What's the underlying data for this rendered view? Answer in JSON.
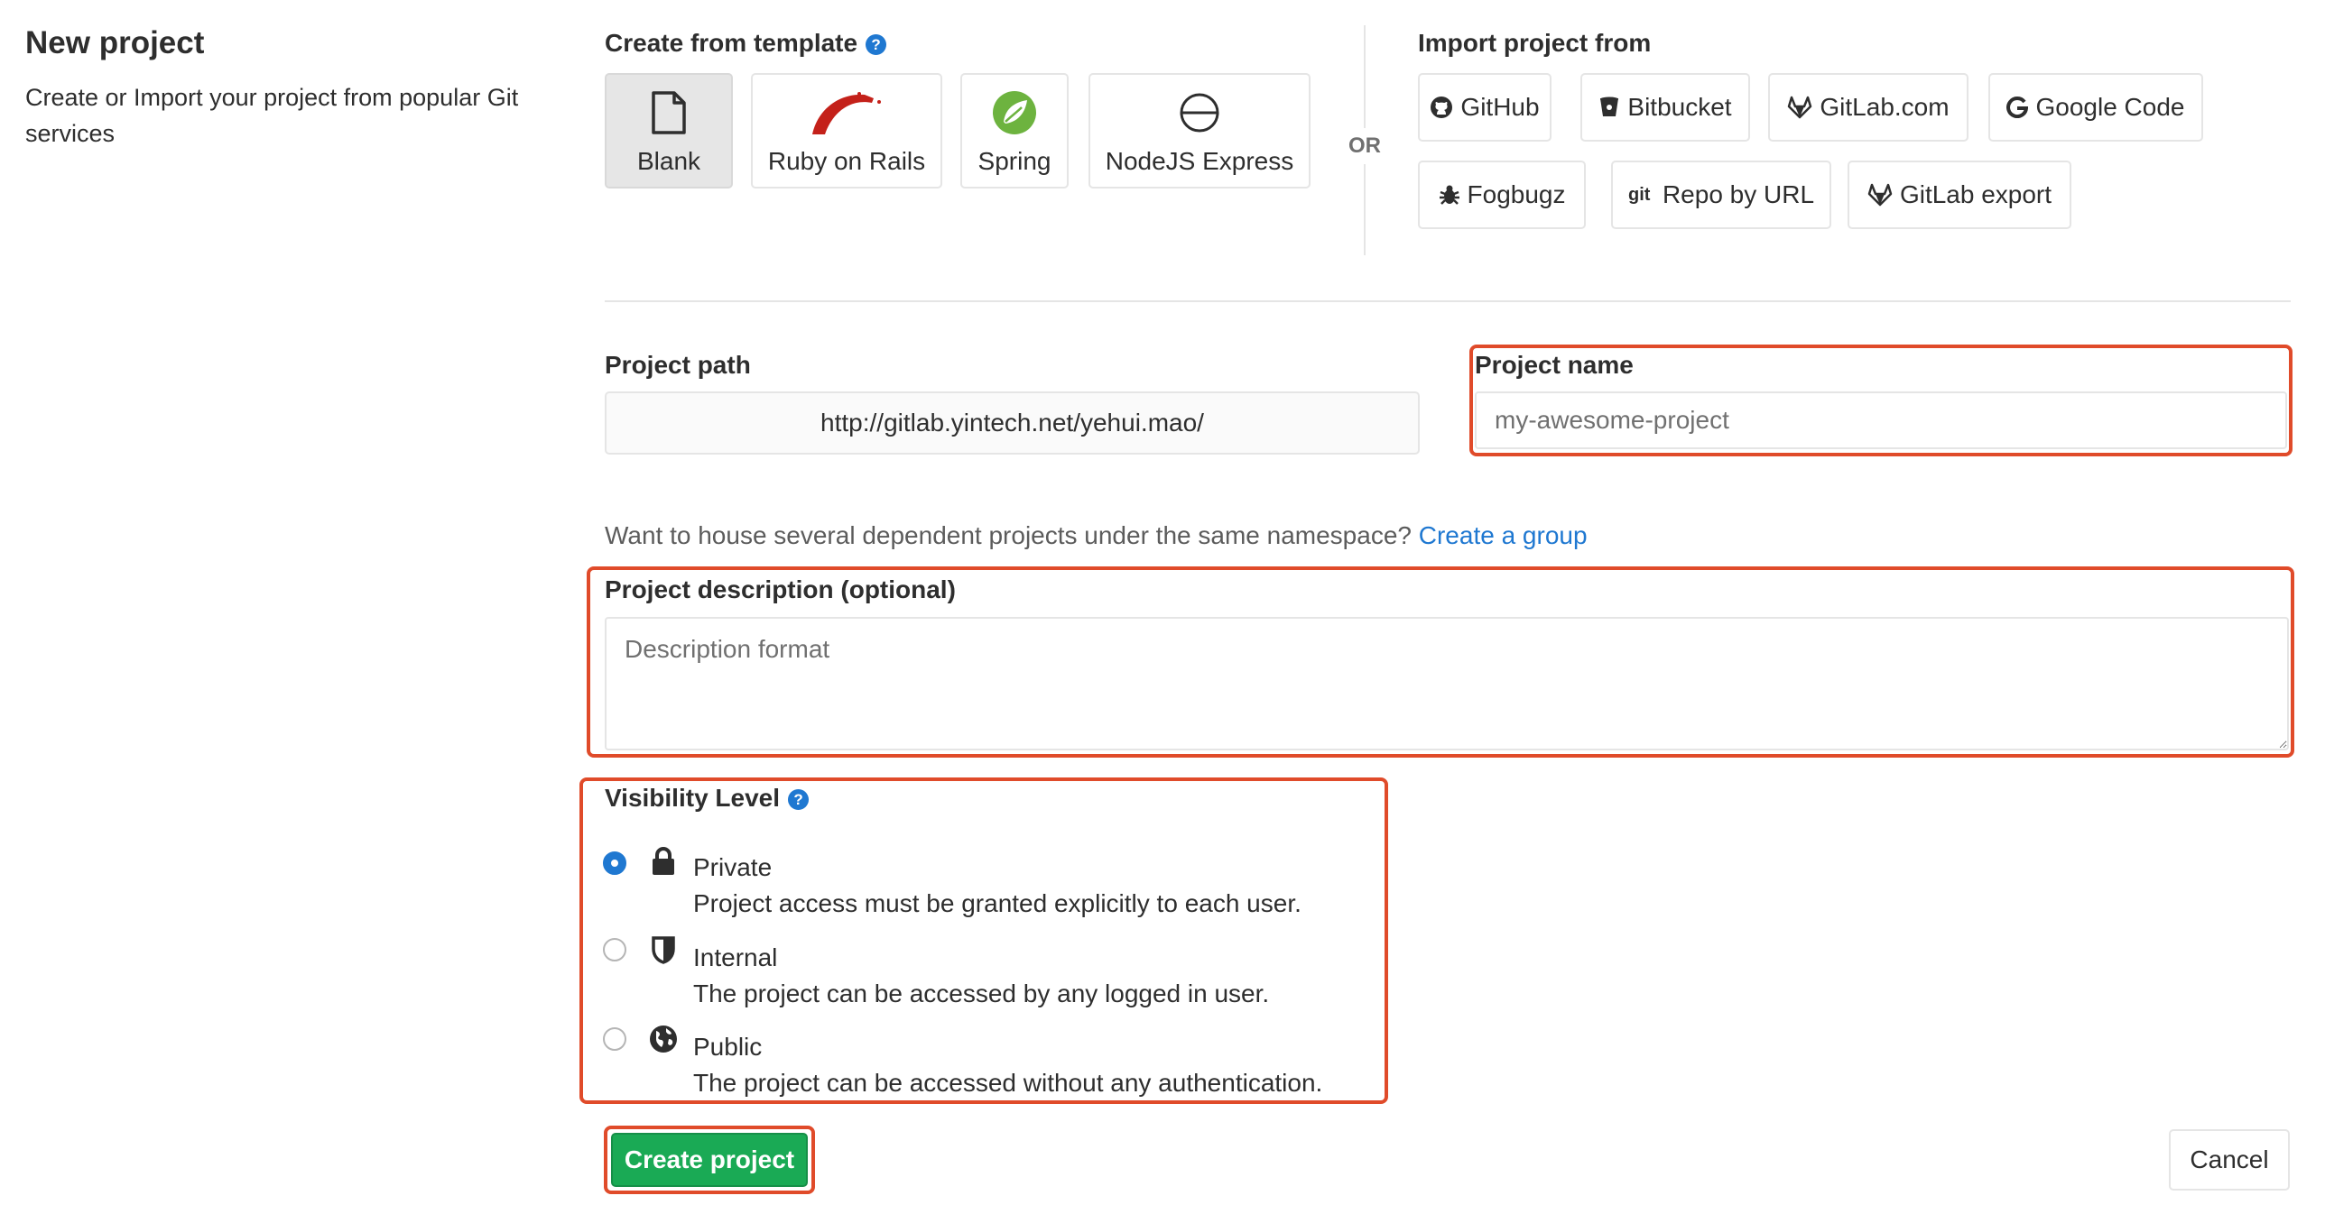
{
  "intro": {
    "title": "New project",
    "subtitle": "Create or Import your project from popular Git services"
  },
  "templates": {
    "title": "Create from template",
    "items": [
      {
        "label": "Blank",
        "icon": "file-icon",
        "active": true
      },
      {
        "label": "Ruby on Rails",
        "icon": "rails-icon"
      },
      {
        "label": "Spring",
        "icon": "spring-icon"
      },
      {
        "label": "NodeJS Express",
        "icon": "express-icon"
      }
    ]
  },
  "divider": {
    "or_text": "OR"
  },
  "import": {
    "title": "Import project from",
    "items": [
      {
        "label": "GitHub",
        "icon": "github-icon"
      },
      {
        "label": "Bitbucket",
        "icon": "bitbucket-icon"
      },
      {
        "label": "GitLab.com",
        "icon": "gitlab-icon"
      },
      {
        "label": "Google Code",
        "icon": "google-icon"
      },
      {
        "label": "Fogbugz",
        "icon": "bug-icon"
      },
      {
        "label": "Repo by URL",
        "icon": "git-icon"
      },
      {
        "label": "GitLab export",
        "icon": "gitlab-icon"
      }
    ]
  },
  "form": {
    "path_label": "Project path",
    "path_value": "http://gitlab.yintech.net/yehui.mao/",
    "name_label": "Project name",
    "name_placeholder": "my-awesome-project",
    "group_hint_text": "Want to house several dependent projects under the same namespace?",
    "group_hint_link": "Create a group",
    "description_label": "Project description (optional)",
    "description_placeholder": "Description format",
    "visibility_label": "Visibility Level",
    "visibility_options": [
      {
        "title": "Private",
        "description": "Project access must be granted explicitly to each user.",
        "icon": "lock-icon",
        "checked": true
      },
      {
        "title": "Internal",
        "description": "The project can be accessed by any logged in user.",
        "icon": "shield-icon",
        "checked": false
      },
      {
        "title": "Public",
        "description": "The project can be accessed without any authentication.",
        "icon": "globe-icon",
        "checked": false
      }
    ],
    "help_glyph": "?"
  },
  "actions": {
    "create_label": "Create project",
    "cancel_label": "Cancel"
  },
  "colors": {
    "accent_blue": "#1f78d1",
    "create_green": "#1aaa55",
    "highlight_red": "#e04b2a"
  }
}
